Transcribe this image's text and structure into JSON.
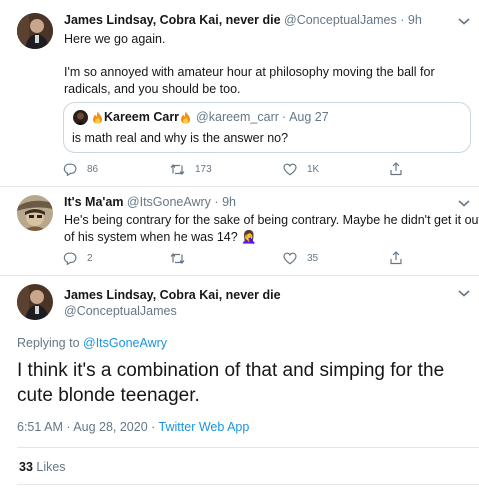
{
  "tweet1": {
    "display_name": "James Lindsay, Cobra Kai, never die",
    "handle": "@ConceptualJames",
    "time": "9h",
    "line1": "Here we go again.",
    "line2": "I'm so annoyed with amateur hour at philosophy moving the ball for",
    "line3": "radicals, and you should be too.",
    "quote": {
      "display_name": "Kareem Carr",
      "handle": "@kareem_carr",
      "date": "Aug 27",
      "text": "is math real and why is the answer no?"
    },
    "replies": "86",
    "retweets": "173",
    "likes": "1K"
  },
  "tweet2": {
    "display_name": "It's Ma'am",
    "handle": "@ItsGoneAwry",
    "time": "9h",
    "line1": "He's being contrary for the sake of being contrary. Maybe he didn't get it out",
    "line2": "of his system when he was 14? 🤦‍♀️",
    "replies": "2",
    "likes": "35"
  },
  "main": {
    "display_name": "James Lindsay, Cobra Kai, never die",
    "handle": "@ConceptualJames",
    "replying_prefix": "Replying to ",
    "replying_to": "@ItsGoneAwry",
    "line1": "I think it's a combination of that and simping for the",
    "line2": "cute blonde teenager.",
    "timestamp": "6:51 AM · Aug 28, 2020 · ",
    "source": "Twitter Web App",
    "likes_count": "33",
    "likes_label": " Likes"
  },
  "colors": {
    "accent": "#1b95e0",
    "muted": "#657786",
    "divider": "#e1e8ed"
  }
}
